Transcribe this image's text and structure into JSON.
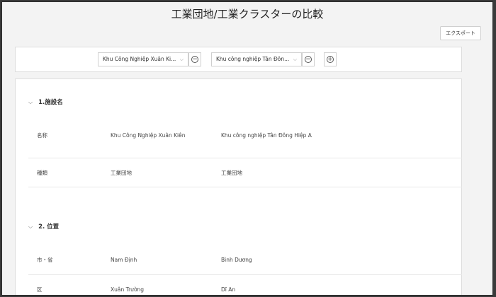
{
  "page": {
    "title": "工業団地/工業クラスターの比較"
  },
  "toolbar": {
    "export_label": "エクスポート"
  },
  "selectors": [
    {
      "value": "Khu Công Nghiệp Xuân Ki...",
      "chevron": "chevron-down-icon",
      "action": "remove-icon"
    },
    {
      "value": "Khu công nghiệp Tân Đôn...",
      "chevron": "chevron-down-icon",
      "action": "remove-icon"
    }
  ],
  "add_button": {
    "icon": "add-icon"
  },
  "sections": [
    {
      "header": "1.施設名",
      "rows": [
        {
          "label": "名称",
          "a": "Khu Công Nghiệp Xuân Kiên",
          "b": "Khu công nghiệp Tân Đông Hiệp A"
        },
        {
          "label": "種類",
          "a": "工業団地",
          "b": "工業団地"
        }
      ]
    },
    {
      "header": "2. 位置",
      "rows": [
        {
          "label": "市・省",
          "a": "Nam Định",
          "b": "Bình Dương"
        },
        {
          "label": "区",
          "a": "Xuân Trường",
          "b": "Dĩ An"
        }
      ]
    }
  ],
  "glyphs": {
    "chevron_down": "⌵",
    "minus": "−",
    "plus": "+",
    "section_chevron": "⌵"
  }
}
